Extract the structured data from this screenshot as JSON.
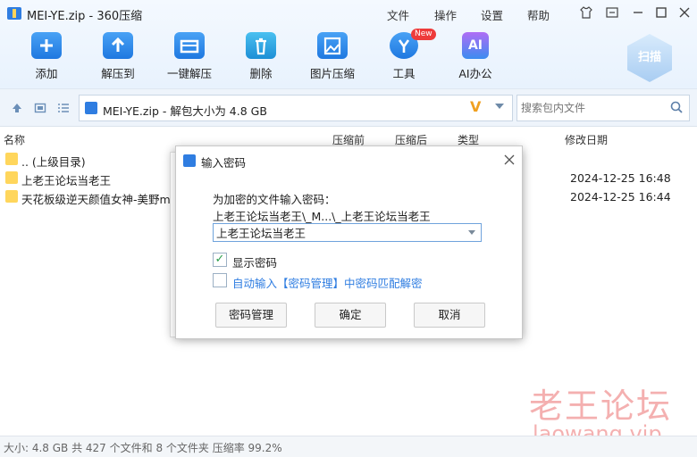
{
  "window": {
    "title": "MEI-YE.zip - 360压缩",
    "menu": [
      "文件",
      "操作",
      "设置",
      "帮助"
    ]
  },
  "toolbar": {
    "items": [
      {
        "label": "添加",
        "icon": "add-icon"
      },
      {
        "label": "解压到",
        "icon": "extract-to-icon"
      },
      {
        "label": "一键解压",
        "icon": "one-click-extract-icon"
      },
      {
        "label": "删除",
        "icon": "delete-icon"
      },
      {
        "label": "图片压缩",
        "icon": "image-compress-icon"
      },
      {
        "label": "工具",
        "icon": "tools-icon",
        "badge": "New"
      },
      {
        "label": "AI办公",
        "icon": "ai-office-icon",
        "glyph": "AI"
      }
    ],
    "scan_label": "扫描"
  },
  "address": {
    "path": "MEI-YE.zip - 解包大小为 4.8 GB",
    "search_placeholder": "搜索包内文件"
  },
  "columns": {
    "name": "名称",
    "compressed_before": "压缩前",
    "compressed_after": "压缩后",
    "type": "类型",
    "modified": "修改日期"
  },
  "files": [
    {
      "name": ".. (上级目录)",
      "date": ""
    },
    {
      "name": "上老王论坛当老王",
      "date": "2024-12-25 16:48"
    },
    {
      "name": "天花板级逆天颜值女神-美野me",
      "date": "2024-12-25 16:44"
    }
  ],
  "dialog": {
    "title": "输入密码",
    "prompt": "为加密的文件输入密码：",
    "path": "上老王论坛当老王\\_M...\\_上老王论坛当老王",
    "password": "上老王论坛当老王",
    "show_password_label": "显示密码",
    "show_password_checked": true,
    "auto_input_label": "自动输入【密码管理】中密码匹配解密",
    "auto_input_checked": false,
    "buttons": {
      "manage": "密码管理",
      "ok": "确定",
      "cancel": "取消"
    }
  },
  "status": {
    "text": "大小: 4.8 GB 共 427 个文件和 8 个文件夹 压缩率 99.2%"
  },
  "watermark": {
    "line1": "老王论坛",
    "line2": "laowang.vip"
  },
  "colors": {
    "accent": "#2f7de1",
    "link": "#2f7de1",
    "watermark": "#e65050"
  }
}
